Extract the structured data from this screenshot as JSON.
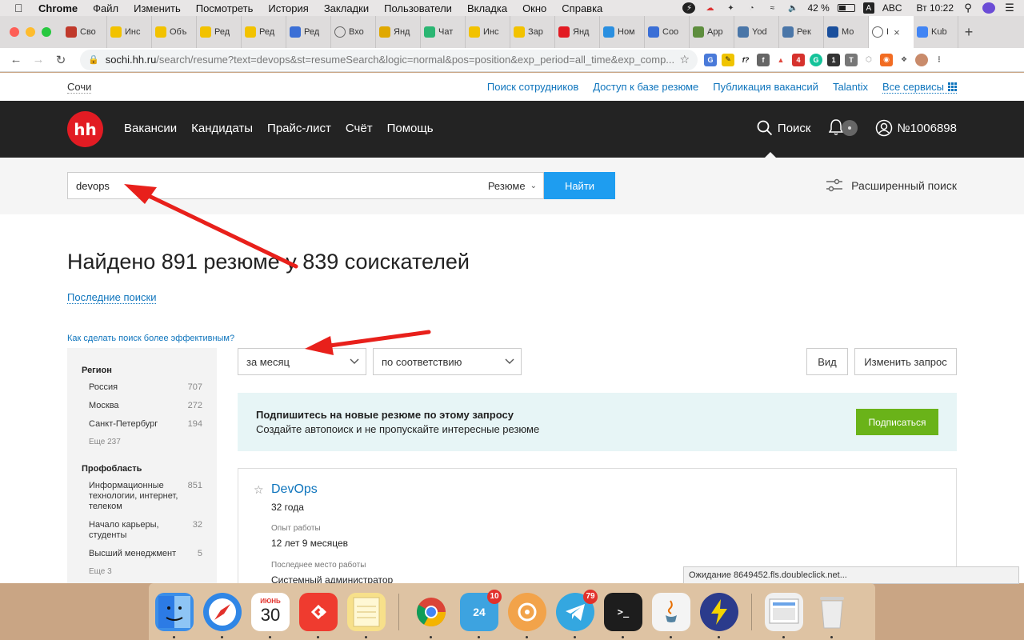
{
  "menubar": {
    "app": "Chrome",
    "items": [
      "Файл",
      "Изменить",
      "Посмотреть",
      "История",
      "Закладки",
      "Пользователи",
      "Вкладка",
      "Окно",
      "Справка"
    ],
    "battery": "42 %",
    "input_lang": "ABC",
    "clock": "Вт 10:22"
  },
  "tabs": [
    {
      "label": "Сво",
      "icon": "code-icon",
      "color": "#c0392b"
    },
    {
      "label": "Инс",
      "icon": "yandex-messenger-icon",
      "color": "#f2c200"
    },
    {
      "label": "Объ",
      "icon": "yandex-messenger-icon",
      "color": "#f2c200"
    },
    {
      "label": "Ред",
      "icon": "yandex-messenger-icon",
      "color": "#f2c200"
    },
    {
      "label": "Ред",
      "icon": "yandex-messenger-icon",
      "color": "#f2c200"
    },
    {
      "label": "Ред",
      "icon": "chart-icon",
      "color": "#3b6fd6"
    },
    {
      "label": "Вхо",
      "icon": "globe-icon",
      "color": "#666666"
    },
    {
      "label": "Янд",
      "icon": "people-icon",
      "color": "#e0a800"
    },
    {
      "label": "Чат",
      "icon": "check-icon",
      "color": "#2bb673"
    },
    {
      "label": "Инс",
      "icon": "yandex-messenger-icon",
      "color": "#f2c200"
    },
    {
      "label": "Зар",
      "icon": "yandex-messenger-icon",
      "color": "#f2c200"
    },
    {
      "label": "Янд",
      "icon": "yandex-icon",
      "color": "#e21b23"
    },
    {
      "label": "Ном",
      "icon": "asterisk-icon",
      "color": "#2a8fe0"
    },
    {
      "label": "Coo",
      "icon": "chat-bubble-icon",
      "color": "#3b6fd6"
    },
    {
      "label": "App",
      "icon": "shopify-icon",
      "color": "#5e8e3e"
    },
    {
      "label": "Yod",
      "icon": "vk-icon",
      "color": "#4a76a8"
    },
    {
      "label": "Рек",
      "icon": "vk-icon",
      "color": "#4a76a8"
    },
    {
      "label": "Мо",
      "icon": "24-icon",
      "color": "#1a4f9c"
    },
    {
      "label": "I",
      "icon": "globe-icon",
      "color": "#666666",
      "active": true
    },
    {
      "label": "Kub",
      "icon": "google-icon",
      "color": "#4285f4"
    }
  ],
  "address": {
    "host": "sochi.hh.ru",
    "path": "/search/resume?text=devops&st=resumeSearch&logic=normal&pos=position&exp_period=all_time&exp_comp..."
  },
  "site": {
    "city": "Сочи",
    "toplinks": [
      "Поиск сотрудников",
      "Доступ к базе резюме",
      "Публикация вакансий",
      "Talantix"
    ],
    "all_services": "Все сервисы",
    "logo": "hh",
    "nav": [
      "Вакансии",
      "Кандидаты",
      "Прайс-лист",
      "Счёт",
      "Помощь"
    ],
    "search_label": "Поиск",
    "account": "№1006898"
  },
  "search": {
    "query": "devops",
    "type": "Резюме",
    "button": "Найти",
    "advanced": "Расширенный поиск"
  },
  "results": {
    "heading": "Найдено 891 резюме у 839 соискателей",
    "recent_searches": "Последние поиски",
    "howto": "Как сделать поиск более эффективным?"
  },
  "filters": {
    "region_title": "Регион",
    "regions": [
      {
        "name": "Россия",
        "count": "707"
      },
      {
        "name": "Москва",
        "count": "272"
      },
      {
        "name": "Санкт-Петербург",
        "count": "194"
      }
    ],
    "regions_more": "Еще 237",
    "prof_title": "Профобласть",
    "profs": [
      {
        "name": "Информационные технологии, интернет, телеком",
        "count": "851"
      },
      {
        "name": "Начало карьеры, студенты",
        "count": "32"
      },
      {
        "name": "Высший менеджмент",
        "count": "5"
      }
    ],
    "profs_more": "Еще 3"
  },
  "controls": {
    "period": "за месяц",
    "sort": "по соответствию",
    "view": "Вид",
    "edit_query": "Изменить запрос"
  },
  "subscribe": {
    "title": "Подпишитесь на новые резюме по этому запросу",
    "text": "Создайте автопоиск и не пропускайте интересные резюме",
    "button": "Подписаться"
  },
  "resume": {
    "title": "DevOps",
    "age": "32 года",
    "exp_label": "Опыт работы",
    "exp_value": "12 лет 9 месяцев",
    "last_label": "Последнее место работы",
    "last_value": "Системный администратор"
  },
  "status": "Ожидание 8649452.fls.doubleclick.net...",
  "dock": [
    {
      "name": "finder-icon",
      "color": "#3b8ee8"
    },
    {
      "name": "safari-icon",
      "color": "#2f86e6"
    },
    {
      "name": "calendar-icon",
      "color": "#ffffff",
      "text": "30",
      "month": "ИЮНЬ"
    },
    {
      "name": "anydesk-icon",
      "color": "#ef3b2f"
    },
    {
      "name": "notes-icon",
      "color": "#f7e08a"
    },
    {
      "name": "chrome-icon",
      "color": "#e9e9e9"
    },
    {
      "name": "24-icon",
      "color": "#3da3e0",
      "text": "24",
      "badge": "10"
    },
    {
      "name": "vpn-icon",
      "color": "#f2a34a"
    },
    {
      "name": "telegram-icon",
      "color": "#34a7e0",
      "badge": "79"
    },
    {
      "name": "terminal-icon",
      "color": "#1d1d1d",
      "text": ">_"
    },
    {
      "name": "java-icon",
      "color": "#f4f4f4"
    },
    {
      "name": "bolt-icon",
      "color": "#2b3b8c"
    },
    {
      "name": "preview-icon",
      "color": "#f0f0f0"
    },
    {
      "name": "trash-icon",
      "color": "#dcdcdc"
    }
  ],
  "colors": {
    "hh_red": "#e21b23",
    "link_blue": "#0f75bd",
    "primary_button": "#1e9df0",
    "subscribe_button": "#6ab319",
    "annotation_arrow": "#e8201b"
  }
}
